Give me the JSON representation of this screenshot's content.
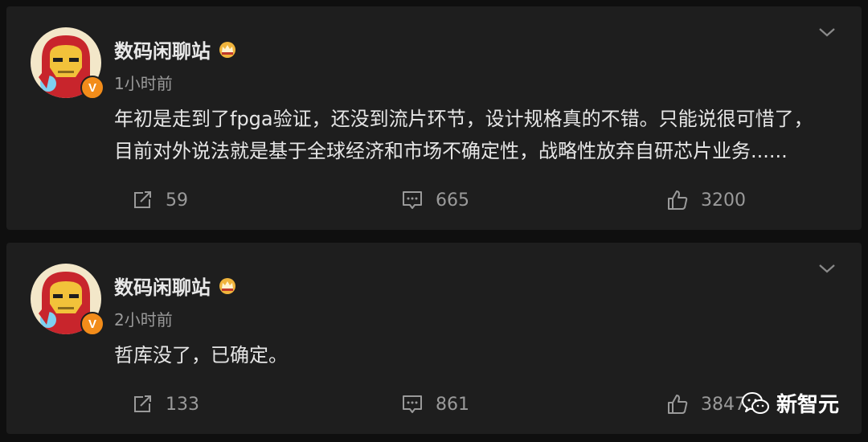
{
  "posts": [
    {
      "username": "数码闲聊站",
      "timestamp": "1小时前",
      "verified_badge": "V",
      "lines": [
        "年初是走到了fpga验证，还没到流片环节，设计规格真的不错。只能说很可惜了，",
        "目前对外说法就是基于全球经济和市场不确定性，战略性放弃自研芯片业务......"
      ],
      "actions": {
        "share": "59",
        "comment": "665",
        "like": "3200"
      }
    },
    {
      "username": "数码闲聊站",
      "timestamp": "2小时前",
      "verified_badge": "V",
      "lines": [
        "哲库没了，已确定。"
      ],
      "actions": {
        "share": "133",
        "comment": "861",
        "like": "3847"
      }
    }
  ],
  "watermark": {
    "text": "新智元"
  },
  "icons": {
    "share": "share-icon",
    "comment": "comment-icon",
    "like": "thumbs-up-icon",
    "menu": "chevron-down-icon",
    "crown": "crown-icon",
    "verified": "verified-v-icon",
    "wechat": "wechat-icon"
  },
  "colors": {
    "background": "#0f0f0f",
    "card": "#1e1e1e",
    "text": "#e6e6e6",
    "muted": "#9a9a9a",
    "verified": "#f28c1a",
    "crown": "#f0b43c"
  }
}
